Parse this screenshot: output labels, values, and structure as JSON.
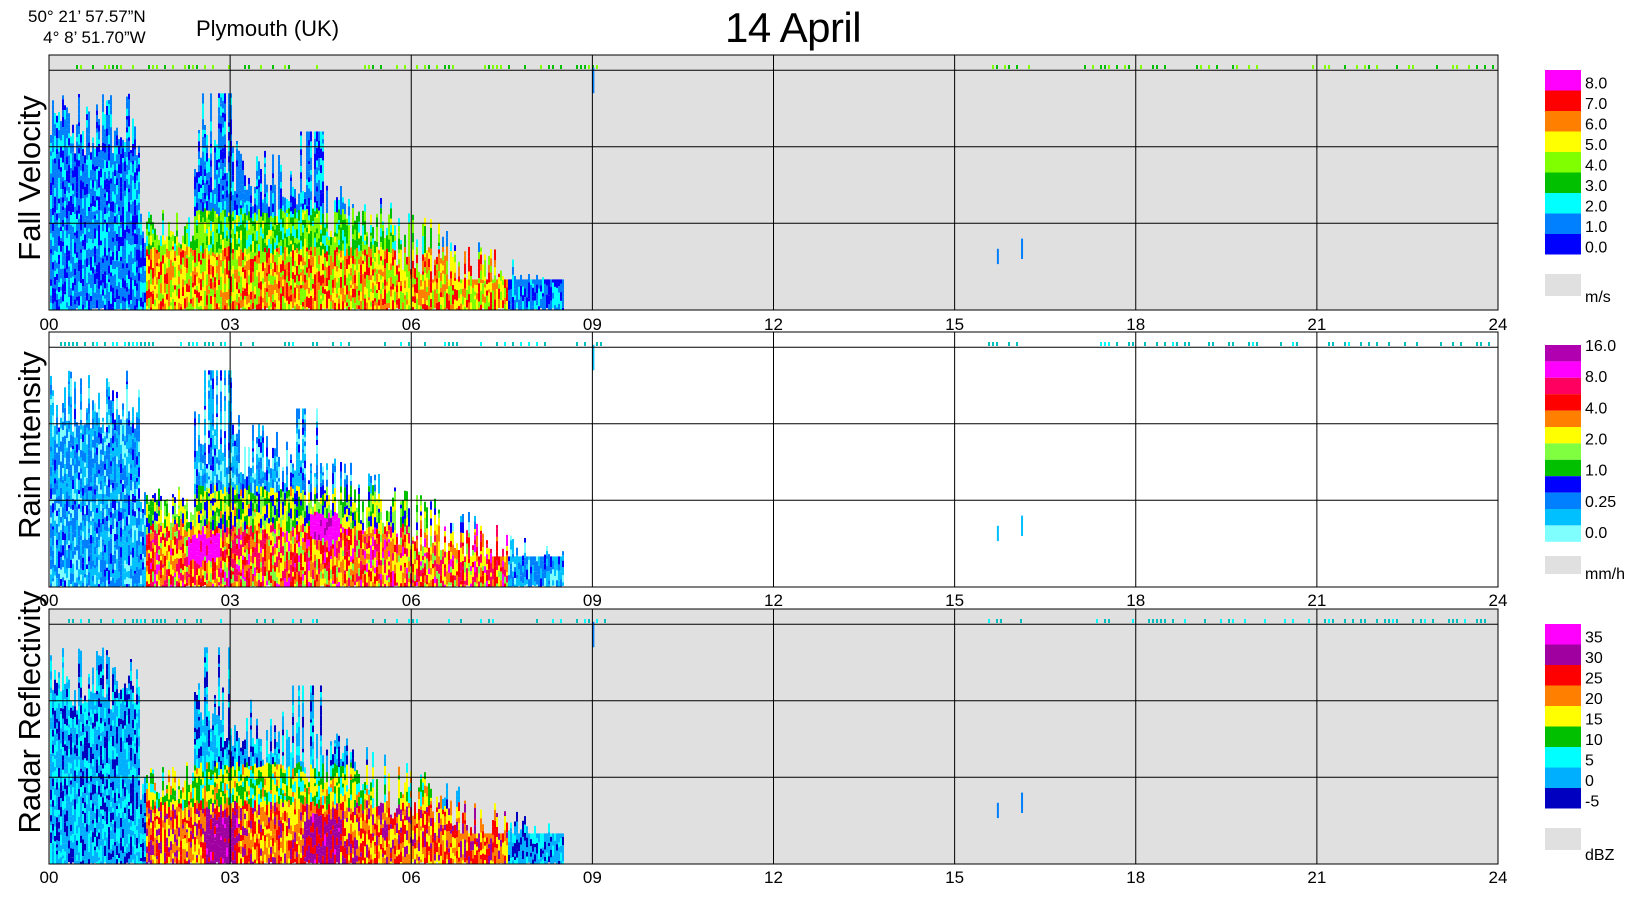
{
  "header": {
    "lat": "50° 21’ 57.57”N",
    "lon": "4°  8’ 51.70”W",
    "location": "Plymouth (UK)",
    "date": "14 April"
  },
  "chart_data": [
    {
      "type": "heatmap",
      "ylabel": "Fall Velocity",
      "x_ticks": [
        "00",
        "03",
        "06",
        "09",
        "12",
        "15",
        "18",
        "21",
        "24"
      ],
      "xlim": [
        0,
        24
      ],
      "background": "#e0e0e0",
      "colorbar": {
        "unit": "m/s",
        "labels": [
          "8.0",
          "7.0",
          "6.0",
          "5.0",
          "4.0",
          "3.0",
          "2.0",
          "1.0",
          "0.0"
        ],
        "colors": [
          "#ff00ff",
          "#ff0000",
          "#ff8000",
          "#ffff00",
          "#80ff00",
          "#00c000",
          "#00ffff",
          "#0080ff",
          "#0000ff"
        ],
        "nodata_color": "#e0e0e0"
      },
      "rain_until_hour": 8.5
    },
    {
      "type": "heatmap",
      "ylabel": "Rain Intensity",
      "x_ticks": [
        "00",
        "03",
        "06",
        "09",
        "12",
        "15",
        "18",
        "21",
        "24"
      ],
      "xlim": [
        0,
        24
      ],
      "background": "#ffffff",
      "colorbar": {
        "unit": "mm/h",
        "labels": [
          "16.0",
          "8.0",
          "4.0",
          "2.0",
          "1.0",
          "0.25",
          "0.0"
        ],
        "colors": [
          "#b000b0",
          "#ff00ff",
          "#ff0060",
          "#ff0000",
          "#ff8000",
          "#ffff00",
          "#80ff40",
          "#00c000",
          "#0000ff",
          "#0080ff",
          "#00c0ff",
          "#80ffff"
        ],
        "nodata_color": "#e0e0e0"
      },
      "rain_until_hour": 8.5
    },
    {
      "type": "heatmap",
      "ylabel": "Radar Reflectivity",
      "x_ticks": [
        "00",
        "03",
        "06",
        "09",
        "12",
        "15",
        "18",
        "21",
        "24"
      ],
      "xlim": [
        0,
        24
      ],
      "background": "#e0e0e0",
      "colorbar": {
        "unit": "dBZ",
        "labels": [
          "35",
          "30",
          "25",
          "20",
          "15",
          "10",
          "5",
          "0",
          "-5"
        ],
        "colors": [
          "#ff00ff",
          "#a000a0",
          "#ff0000",
          "#ff8000",
          "#ffff00",
          "#00c000",
          "#00ffff",
          "#00b0ff",
          "#0000c0"
        ],
        "nodata_color": "#e0e0e0"
      },
      "rain_until_hour": 8.5
    }
  ]
}
